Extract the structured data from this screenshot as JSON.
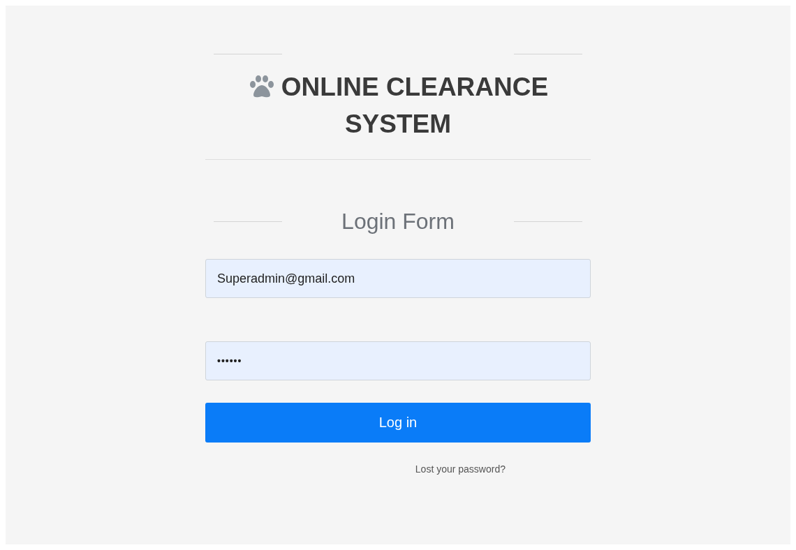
{
  "brand": {
    "title": "ONLINE CLEARANCE SYSTEM"
  },
  "form": {
    "heading": "Login Form",
    "fields": [
      {
        "kind": "email",
        "value": "Superadmin@gmail.com"
      },
      {
        "kind": "password",
        "value": "••••••"
      }
    ],
    "submit": "Log in",
    "link": "Lost your password?"
  }
}
